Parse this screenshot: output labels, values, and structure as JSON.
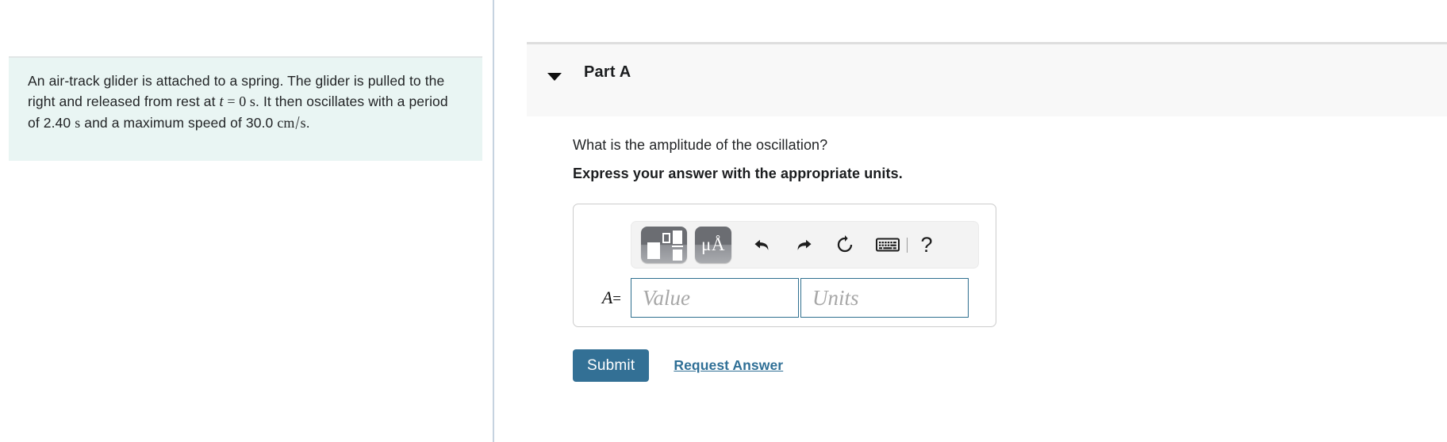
{
  "problem": {
    "text_part1": "An air-track glider is attached to a spring. The glider is pulled to the right and released from rest at ",
    "var_t": "t",
    "eq_zero": " = 0 ",
    "unit_s1": "s",
    "text_part2": ". It then oscillates with a period of 2.40 ",
    "unit_s2": "s",
    "text_part3": " and a maximum speed of 30.0 ",
    "unit_cm": "cm",
    "slash": "/",
    "unit_s3": "s",
    "text_end": "."
  },
  "part": {
    "title": "Part A",
    "toggle_icon": "caret-down-icon",
    "question": "What is the amplitude of the oscillation?",
    "instruction": "Express your answer with the appropriate units."
  },
  "toolbar": {
    "template_button": "math-template-icon",
    "units_button_label": "μÅ",
    "undo_icon": "undo-arrow-icon",
    "redo_icon": "redo-arrow-icon",
    "reset_icon": "reset-circular-arrow-icon",
    "keyboard_icon": "keyboard-icon",
    "help_label": "?"
  },
  "answer": {
    "variable": "A",
    "equals": "=",
    "value_placeholder": "Value",
    "value_current": "",
    "units_placeholder": "Units",
    "units_current": ""
  },
  "actions": {
    "submit_label": "Submit",
    "request_answer_label": "Request Answer"
  },
  "colors": {
    "problem_box_bg": "#e9f5f3",
    "submit_bg": "#337095",
    "link": "#2f6f96",
    "input_border": "#2f6f8f",
    "part_header_bg": "#f8f8f8",
    "divider": "#c6d3e0"
  }
}
